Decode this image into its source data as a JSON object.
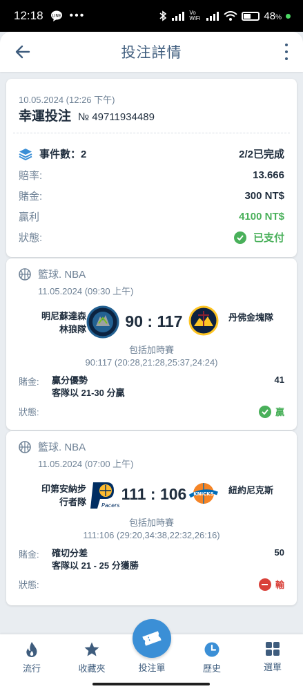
{
  "status_bar": {
    "time": "12:18",
    "battery": "48",
    "battery_suffix": "%",
    "network_label": "Vo WiFi"
  },
  "header": {
    "title": "投注詳情"
  },
  "summary": {
    "date": "10.05.2024 (12:26 下午)",
    "bet_type": "幸運投注",
    "bet_number": "№ 49711934489",
    "events_label": "事件數：2",
    "events_progress": "2/2已完成",
    "odds_label": "賠率:",
    "odds_value": "13.666",
    "stake_label": "賭金:",
    "stake_value": "300 NT$",
    "win_label": "贏利",
    "win_value": "4100 NT$",
    "status_label": "狀態:",
    "status_value": "已支付"
  },
  "events": [
    {
      "league": "籃球. NBA",
      "time": "11.05.2024 (09:30 上午)",
      "home_team_line1": "明尼蘇達森",
      "home_team_line2": "林狼隊",
      "score": "90 : 117",
      "away_team": "丹佛金塊隊",
      "ot_label": "包括加時賽",
      "ot_detail": "90:117 (20:28,21:28,25:37,24:24)",
      "stake_label": "賭金:",
      "bet_line1": "贏分優勢",
      "bet_line2": "客隊以 21-30 分贏",
      "odds": "41",
      "status_label": "狀態:",
      "result": "贏",
      "result_type": "win"
    },
    {
      "league": "籃球. NBA",
      "time": "11.05.2024 (07:00 上午)",
      "home_team_line1": "印第安納步",
      "home_team_line2": "行者隊",
      "score": "111 : 106",
      "away_team": "紐約尼克斯",
      "ot_label": "包括加時賽",
      "ot_detail": "111:106 (29:20,34:38,22:32,26:16)",
      "stake_label": "賭金:",
      "bet_line1": "確切分差",
      "bet_line2": "客隊以 21 - 25 分獲勝",
      "odds": "50",
      "status_label": "狀態:",
      "result": "輸",
      "result_type": "loss"
    }
  ],
  "bottom_nav": {
    "items": [
      {
        "label": "流行",
        "icon": "flame-icon"
      },
      {
        "label": "收藏夾",
        "icon": "star-icon"
      },
      {
        "label": "投注單",
        "icon": "ticket-icon"
      },
      {
        "label": "歷史",
        "icon": "clock-icon"
      },
      {
        "label": "選單",
        "icon": "grid-icon"
      }
    ]
  },
  "colors": {
    "accent": "#3b8fd6",
    "win": "#49b05a",
    "loss": "#d9413a",
    "text_muted": "#6f8296",
    "nav": "#3e5c7d"
  }
}
